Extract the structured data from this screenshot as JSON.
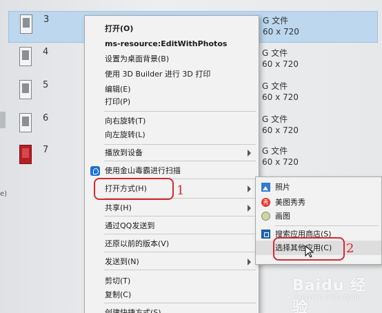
{
  "files": [
    {
      "name": "3",
      "type": "G 文件",
      "dims": "60 x 720",
      "selected": true,
      "thumb": "white"
    },
    {
      "name": "4",
      "type": "G 文件",
      "dims": "60 x 720",
      "selected": false,
      "thumb": "white"
    },
    {
      "name": "5",
      "type": "G 文件",
      "dims": "60 x 720",
      "selected": false,
      "thumb": "white"
    },
    {
      "name": "6",
      "type": "G 文件",
      "dims": "60 x 720",
      "selected": false,
      "thumb": "white"
    },
    {
      "name": "7",
      "type": "G 文件",
      "dims": "60 x 720",
      "selected": false,
      "thumb": "red"
    }
  ],
  "left_edge_char": "e)",
  "context_menu": {
    "open": "打开(O)",
    "edit_with_photos": "ms-resource:EditWithPhotos",
    "set_wallpaper": "设置为桌面背景(B)",
    "print_3d": "使用 3D Builder 进行 3D 打印",
    "edit": "编辑(E)",
    "print": "打印(P)",
    "rotate_right": "向右旋转(T)",
    "rotate_left": "向左旋转(L)",
    "cast_to_device": "播放到设备",
    "scan": "使用金山毒霸进行扫描",
    "open_with": "打开方式(H)",
    "share": "共享(H)",
    "send_qq": "通过QQ发送到",
    "restore_versions": "还原以前的版本(V)",
    "send_to": "发送到(N)",
    "cut": "剪切(T)",
    "copy": "复制(C)",
    "create_shortcut": "创建快捷方式(S)"
  },
  "submenu": {
    "photos": "照片",
    "meitu": "美图秀秀",
    "paint": "画图",
    "store_search": "搜索应用商店(S)",
    "choose_other": "选择其他应用(C)"
  },
  "annotations": {
    "step1": "1",
    "step2": "2"
  },
  "watermark": {
    "logo": "Baidu 经验",
    "url": "jingyan.baidu.com"
  },
  "colors": {
    "selection": "#bcd7ee",
    "annotation": "#d8262c",
    "menu_bg": "#f2f2f2"
  }
}
